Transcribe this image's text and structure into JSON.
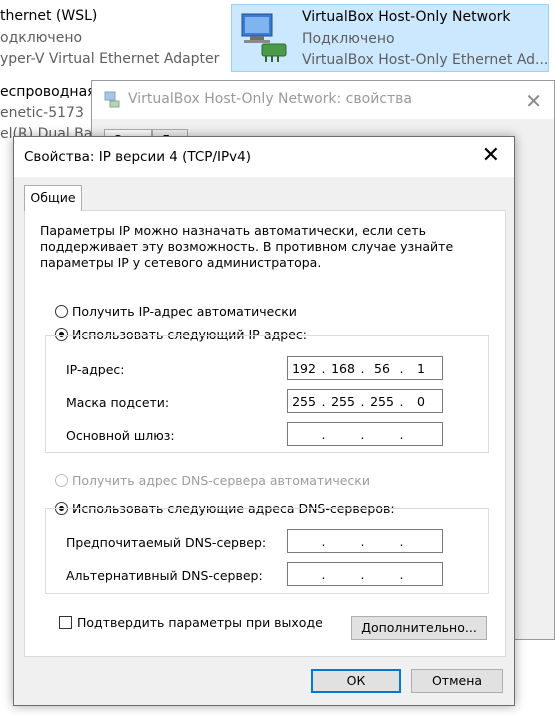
{
  "background": {
    "connections": [
      {
        "name": "thernet (WSL)",
        "status": "одключено",
        "adapter": "yper-V Virtual Ethernet Adapter"
      },
      {
        "name": "есп",
        "status": "",
        "adapter": ""
      },
      {
        "name": "VirtualBox Host-Only Network",
        "status": "Подключено",
        "adapter": "VirtualBox Host-Only Ethernet Ad..."
      },
      {
        "name": "еспроводная с",
        "status": "enetic-5173",
        "adapter": "el(R) Dual Ba"
      }
    ]
  },
  "props_window": {
    "title": "VirtualBox Host-Only Network: свойства",
    "tab1": "Сет",
    "tab2": "Д"
  },
  "dialog": {
    "title": "Свойства: IP версии 4 (TCP/IPv4)",
    "close_glyph": "✕",
    "tab_general": "Общие",
    "description": "Параметры IP можно назначать автоматически, если сеть поддерживает эту возможность. В противном случае узнайте параметры IP у сетевого администратора.",
    "ip_auto_label": "Получить IP-адрес автоматически",
    "ip_manual_label": "Использовать следующий IP-адрес:",
    "ip_address_label": "IP-адрес:",
    "ip_address": [
      "192",
      "168",
      "56",
      "1"
    ],
    "subnet_label": "Маска подсети:",
    "subnet": [
      "255",
      "255",
      "255",
      "0"
    ],
    "gateway_label": "Основной шлюз:",
    "gateway": [
      "",
      "",
      "",
      ""
    ],
    "dns_auto_label": "Получить адрес DNS-сервера автоматически",
    "dns_manual_label": "Использовать следующие адреса DNS-серверов:",
    "dns_pref_label": "Предпочитаемый DNS-сервер:",
    "dns_pref": [
      "",
      "",
      "",
      ""
    ],
    "dns_alt_label": "Альтернативный DNS-сервер:",
    "dns_alt": [
      "",
      "",
      "",
      ""
    ],
    "validate_label": "Подтвердить параметры при выходе",
    "advanced_label": "Дополнительно...",
    "ok_label": "ОК",
    "cancel_label": "Отмена",
    "dot": "."
  }
}
